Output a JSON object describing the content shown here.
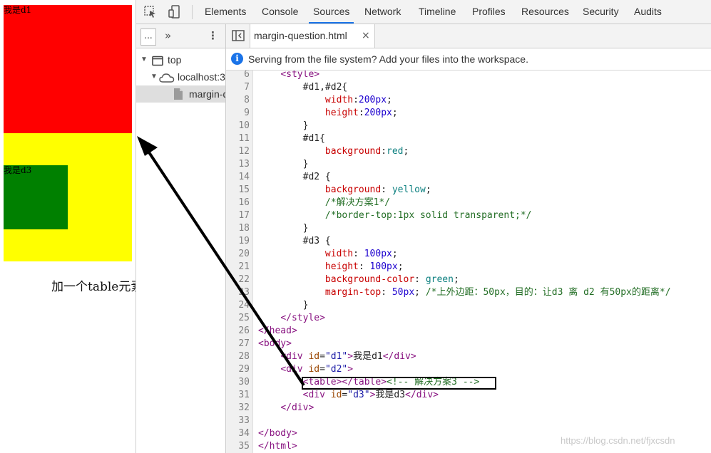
{
  "rendered_page": {
    "d1_text": "我是d1",
    "d3_text": "我是d3",
    "annotation": "加一个table元素就可以了",
    "colors": {
      "d1": "#ff0000",
      "d2": "#ffff00",
      "d3": "#008000"
    }
  },
  "devtools": {
    "tabs": [
      "Elements",
      "Console",
      "Sources",
      "Network",
      "Timeline",
      "Profiles",
      "Resources",
      "Security",
      "Audits"
    ],
    "active_tab": "Sources",
    "navigator": {
      "more_label": "...",
      "tree": [
        {
          "label": "top"
        },
        {
          "label": "localhost:3"
        },
        {
          "label": "margin-question.html"
        }
      ]
    },
    "editor": {
      "file_tab": "margin-question.html",
      "close_glyph": "×",
      "info_message": "Serving from the file system? Add your files into the workspace.",
      "lines": [
        {
          "n": "6",
          "parts": [
            [
              "    ",
              "p"
            ],
            [
              "<style>",
              "tag"
            ]
          ]
        },
        {
          "n": "7",
          "parts": [
            [
              "        #d1,#d2{",
              "p"
            ]
          ]
        },
        {
          "n": "8",
          "parts": [
            [
              "            ",
              "p"
            ],
            [
              "width",
              "prop"
            ],
            [
              ":",
              "p"
            ],
            [
              "200px",
              "val"
            ],
            [
              ";",
              "p"
            ]
          ]
        },
        {
          "n": "9",
          "parts": [
            [
              "            ",
              "p"
            ],
            [
              "height",
              "prop"
            ],
            [
              ":",
              "p"
            ],
            [
              "200px",
              "val"
            ],
            [
              ";",
              "p"
            ]
          ]
        },
        {
          "n": "10",
          "parts": [
            [
              "        }",
              "p"
            ]
          ]
        },
        {
          "n": "11",
          "parts": [
            [
              "        #d1{",
              "p"
            ]
          ]
        },
        {
          "n": "12",
          "parts": [
            [
              "            ",
              "p"
            ],
            [
              "background",
              "prop"
            ],
            [
              ":",
              "p"
            ],
            [
              "red",
              "kw"
            ],
            [
              ";",
              "p"
            ]
          ]
        },
        {
          "n": "13",
          "parts": [
            [
              "        }",
              "p"
            ]
          ]
        },
        {
          "n": "14",
          "parts": [
            [
              "        #d2 {",
              "p"
            ]
          ]
        },
        {
          "n": "15",
          "parts": [
            [
              "            ",
              "p"
            ],
            [
              "background",
              "prop"
            ],
            [
              ": ",
              "p"
            ],
            [
              "yellow",
              "kw"
            ],
            [
              ";",
              "p"
            ]
          ]
        },
        {
          "n": "16",
          "parts": [
            [
              "            ",
              "p"
            ],
            [
              "/*解决方案1*/",
              "cmt"
            ]
          ]
        },
        {
          "n": "17",
          "parts": [
            [
              "            ",
              "p"
            ],
            [
              "/*border-top:1px solid transparent;*/",
              "cmt"
            ]
          ]
        },
        {
          "n": "18",
          "parts": [
            [
              "        }",
              "p"
            ]
          ]
        },
        {
          "n": "19",
          "parts": [
            [
              "        #d3 {",
              "p"
            ]
          ]
        },
        {
          "n": "20",
          "parts": [
            [
              "            ",
              "p"
            ],
            [
              "width",
              "prop"
            ],
            [
              ": ",
              "p"
            ],
            [
              "100px",
              "val"
            ],
            [
              ";",
              "p"
            ]
          ]
        },
        {
          "n": "21",
          "parts": [
            [
              "            ",
              "p"
            ],
            [
              "height",
              "prop"
            ],
            [
              ": ",
              "p"
            ],
            [
              "100px",
              "val"
            ],
            [
              ";",
              "p"
            ]
          ]
        },
        {
          "n": "22",
          "parts": [
            [
              "            ",
              "p"
            ],
            [
              "background-color",
              "prop"
            ],
            [
              ": ",
              "p"
            ],
            [
              "green",
              "kw"
            ],
            [
              ";",
              "p"
            ]
          ]
        },
        {
          "n": "23",
          "parts": [
            [
              "            ",
              "p"
            ],
            [
              "margin-top",
              "prop"
            ],
            [
              ": ",
              "p"
            ],
            [
              "50px",
              "val"
            ],
            [
              "; ",
              "p"
            ],
            [
              "/*上外边距：50px，目的：让d3 离 d2 有50px的距离*/",
              "cmt"
            ]
          ]
        },
        {
          "n": "24",
          "parts": [
            [
              "        }",
              "p"
            ]
          ]
        },
        {
          "n": "25",
          "parts": [
            [
              "    ",
              "p"
            ],
            [
              "</style>",
              "tag"
            ]
          ]
        },
        {
          "n": "26",
          "parts": [
            [
              "</head>",
              "tag"
            ]
          ]
        },
        {
          "n": "27",
          "parts": [
            [
              "<body>",
              "tag"
            ]
          ]
        },
        {
          "n": "28",
          "parts": [
            [
              "    ",
              "p"
            ],
            [
              "<div ",
              "tag"
            ],
            [
              "id",
              "attr"
            ],
            [
              "=",
              "p"
            ],
            [
              "\"d1\"",
              "str"
            ],
            [
              ">",
              "tag"
            ],
            [
              "我是d1",
              "p"
            ],
            [
              "</div>",
              "tag"
            ]
          ]
        },
        {
          "n": "29",
          "parts": [
            [
              "    ",
              "p"
            ],
            [
              "<div ",
              "tag"
            ],
            [
              "id",
              "attr"
            ],
            [
              "=",
              "p"
            ],
            [
              "\"d2\"",
              "str"
            ],
            [
              ">",
              "tag"
            ]
          ]
        },
        {
          "n": "30",
          "parts": [
            [
              "        ",
              "p"
            ],
            [
              "<table></table>",
              "tag"
            ],
            [
              "<!-- 解决方案3 -->",
              "cmt"
            ]
          ]
        },
        {
          "n": "31",
          "parts": [
            [
              "        ",
              "p"
            ],
            [
              "<div ",
              "tag"
            ],
            [
              "id",
              "attr"
            ],
            [
              "=",
              "p"
            ],
            [
              "\"d3\"",
              "str"
            ],
            [
              ">",
              "tag"
            ],
            [
              "我是d3",
              "p"
            ],
            [
              "</div>",
              "tag"
            ]
          ]
        },
        {
          "n": "32",
          "parts": [
            [
              "    ",
              "p"
            ],
            [
              "</div>",
              "tag"
            ]
          ]
        },
        {
          "n": "33",
          "parts": [
            [
              "",
              "p"
            ]
          ]
        },
        {
          "n": "34",
          "parts": [
            [
              "</body>",
              "tag"
            ]
          ]
        },
        {
          "n": "35",
          "parts": [
            [
              "</html>",
              "tag"
            ]
          ]
        }
      ],
      "syntax_colors": {
        "p": "#222222",
        "tag": "#881280",
        "prop": "#c80000",
        "val": "#1c00cf",
        "kw": "#0d8080",
        "cmt": "#236e25",
        "attr": "#994500",
        "str": "#1a1aa6"
      }
    },
    "watermark": "https://blog.csdn.net/fjxcsdn"
  }
}
